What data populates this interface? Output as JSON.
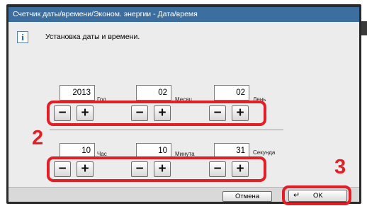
{
  "window": {
    "title": "Счетчик даты/времени/Эконом. энергии - Дата/время"
  },
  "message": "Установка даты и времени.",
  "info_icon": "i",
  "date": {
    "year": {
      "value": "2013",
      "unit": "Год"
    },
    "month": {
      "value": "02",
      "unit": "Месяц"
    },
    "day": {
      "value": "02",
      "unit": "День"
    }
  },
  "time": {
    "hour": {
      "value": "10",
      "unit": "Час"
    },
    "minute": {
      "value": "10",
      "unit": "Минута"
    },
    "second": {
      "value": "31",
      "unit": "Секунда"
    }
  },
  "stepper": {
    "minus": "−",
    "plus": "+"
  },
  "callouts": {
    "steppers": "2",
    "ok": "3"
  },
  "buttons": {
    "cancel": "Отмена",
    "ok": "OK",
    "enter_icon": "↵"
  },
  "colors": {
    "titlebar": "#3c6fa0",
    "highlight": "#e21e26"
  }
}
